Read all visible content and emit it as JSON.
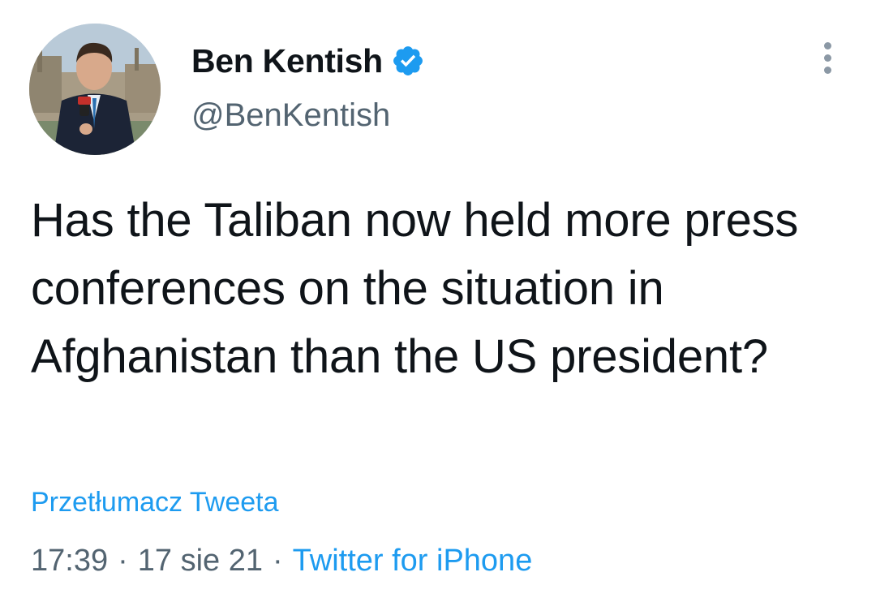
{
  "tweet": {
    "author": {
      "display_name": "Ben Kentish",
      "handle": "@BenKentish",
      "verified_icon": "verified-badge-icon",
      "avatar": "profile-photo"
    },
    "text": "Has the Taliban now held more press conferences on the situation in Afghanistan than the US president?",
    "translate_label": "Przetłumacz Tweeta",
    "time": "17:39",
    "date": "17 sie 21",
    "separator": "·",
    "source": "Twitter for iPhone",
    "more_icon": "more-vertical-icon"
  },
  "colors": {
    "link": "#1d9bf0",
    "text": "#0f1419",
    "secondary": "#536471",
    "verified": "#1d9bf0"
  }
}
